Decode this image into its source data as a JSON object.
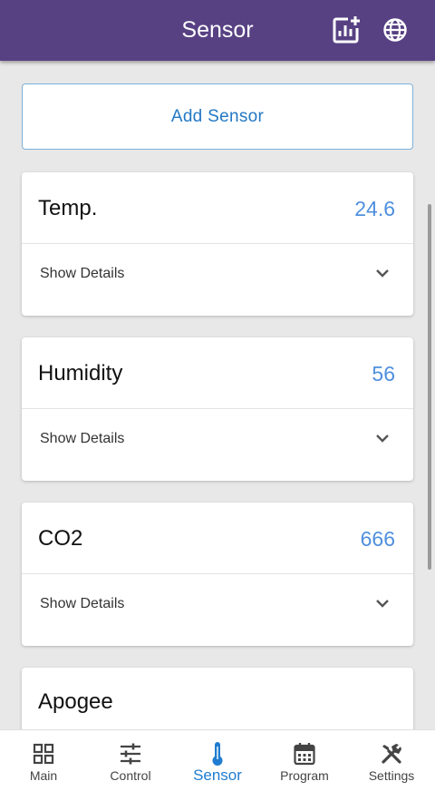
{
  "header": {
    "title": "Sensor",
    "icons": [
      "chart-add-icon",
      "globe-icon"
    ]
  },
  "add_button": {
    "label": "Add Sensor"
  },
  "sensors": [
    {
      "name": "Temp.",
      "value": "24.6",
      "details_label": "Show Details"
    },
    {
      "name": "Humidity",
      "value": "56",
      "details_label": "Show Details"
    },
    {
      "name": "CO2",
      "value": "666",
      "details_label": "Show Details"
    },
    {
      "name": "Apogee"
    }
  ],
  "nav": {
    "items": [
      {
        "label": "Main",
        "icon": "grid-icon"
      },
      {
        "label": "Control",
        "icon": "sliders-icon"
      },
      {
        "label": "Sensor",
        "icon": "thermometer-icon"
      },
      {
        "label": "Program",
        "icon": "calendar-icon"
      },
      {
        "label": "Settings",
        "icon": "tools-icon"
      }
    ],
    "active": "Sensor"
  },
  "colors": {
    "header_bg": "#574183",
    "accent": "#2378c4",
    "value_text": "#4f8fdd",
    "page_bg": "#e8e8e8"
  }
}
